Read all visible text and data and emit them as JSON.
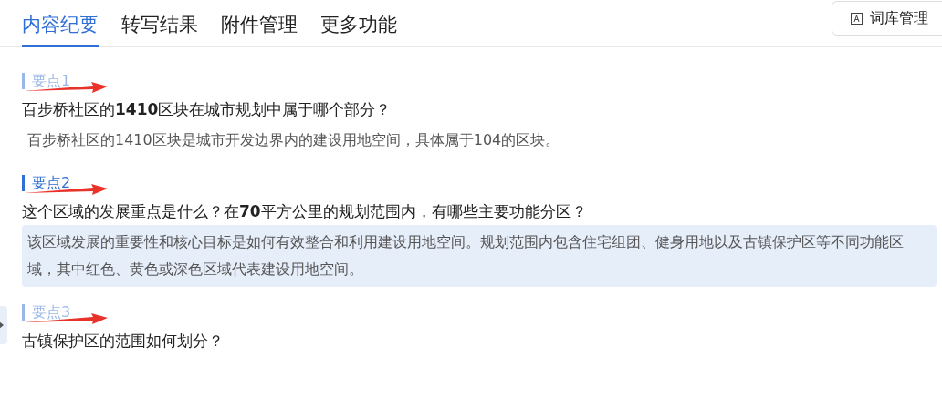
{
  "tabs": [
    {
      "label": "内容纪要",
      "selected": true
    },
    {
      "label": "转写结果",
      "selected": false
    },
    {
      "label": "附件管理",
      "selected": false
    },
    {
      "label": "更多功能",
      "selected": false
    }
  ],
  "glossary_button": {
    "label": "词库管理"
  },
  "points": [
    {
      "label": "要点1",
      "selected": false,
      "question": "百步桥社区的**1410**区块在城市规划中属于哪个部分？",
      "answer": "百步桥社区的1410区块是城市开发边界内的建设用地空间，具体属于104的区块。"
    },
    {
      "label": "要点2",
      "selected": true,
      "question": "这个区域的发展重点是什么？在**70**平方公里的规划范围内，有哪些主要功能分区？",
      "answer": "该区域发展的重要性和核心目标是如何有效整合和利用建设用地空间。规划范围内包含住宅组团、健身用地以及古镇保护区等不同功能区域，其中红色、黄色或深色区域代表建设用地空间。"
    },
    {
      "label": "要点3",
      "selected": false,
      "question": "古镇保护区的范围如何划分？"
    }
  ]
}
